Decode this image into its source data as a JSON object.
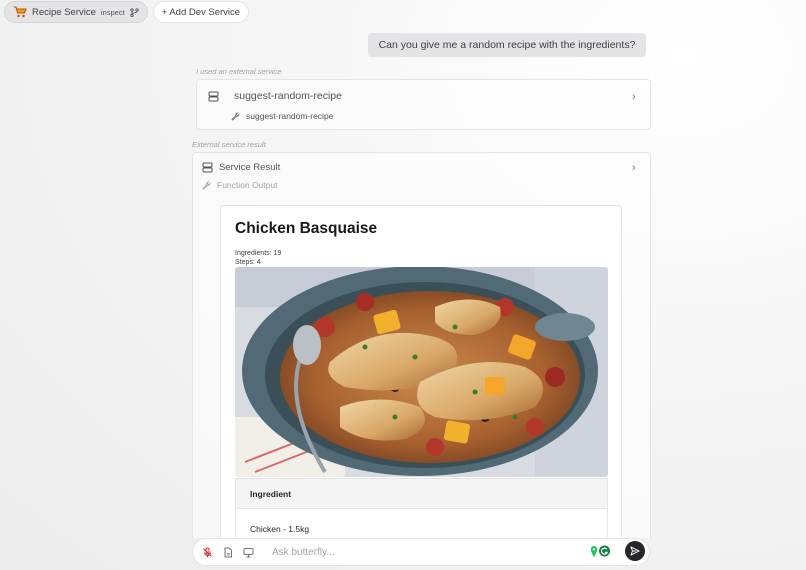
{
  "topbar": {
    "service_label": "Recipe Service",
    "inspect_label": "inspect",
    "add_dev_label": "+ Add Dev Service"
  },
  "chat": {
    "user_message": "Can you give me a random recipe with the ingredients?",
    "tool_caption": "I used an external service",
    "tool_name": "suggest-random-recipe",
    "tool_function": "suggest-random-recipe",
    "result_caption": "External service result",
    "result_title": "Service Result",
    "result_subtitle": "Function Output"
  },
  "recipe": {
    "title": "Chicken Basquaise",
    "ingredients_count": "Ingredients: 19",
    "steps_count": "Steps: 4",
    "table_header": "Ingredient",
    "ingredients": [
      "Chicken - 1.5kg"
    ]
  },
  "composer": {
    "placeholder": "Ask butterfly..."
  },
  "icons": {
    "service": "cart-icon",
    "server": "server-icon",
    "function": "wrench-icon",
    "chevron": "chevron-right-icon",
    "mic_off": "mic-off-icon",
    "file": "file-icon",
    "monitor": "monitor-icon",
    "send": "send-icon"
  },
  "colors": {
    "user_bubble": "#e4e4e7",
    "send_button": "#27272a"
  }
}
